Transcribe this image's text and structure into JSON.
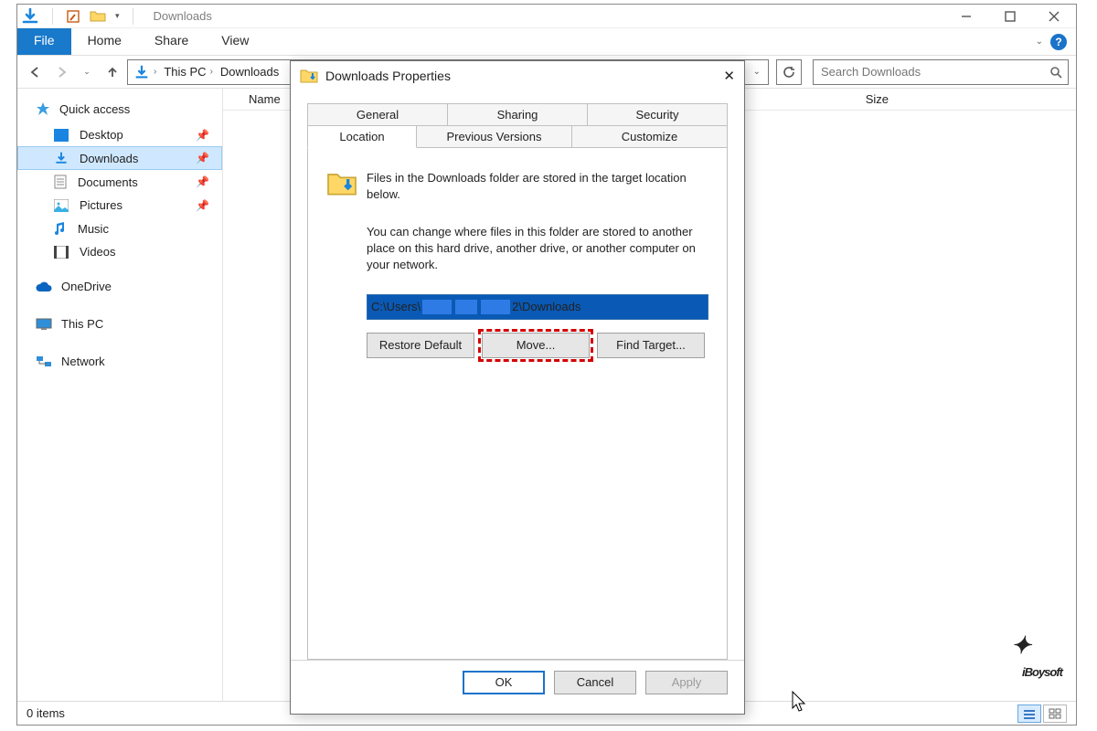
{
  "window": {
    "title": "Downloads",
    "menus": {
      "file": "File",
      "home": "Home",
      "share": "Share",
      "view": "View"
    },
    "breadcrumb": {
      "root": "This PC",
      "cur": "Downloads"
    },
    "search_placeholder": "Search Downloads",
    "columns": {
      "name": "Name",
      "size": "Size"
    },
    "status": "0 items"
  },
  "sidebar": {
    "quick_access": "Quick access",
    "items": [
      {
        "label": "Desktop",
        "icon": "desktop"
      },
      {
        "label": "Downloads",
        "icon": "downloads",
        "selected": true
      },
      {
        "label": "Documents",
        "icon": "documents"
      },
      {
        "label": "Pictures",
        "icon": "pictures"
      },
      {
        "label": "Music",
        "icon": "music"
      },
      {
        "label": "Videos",
        "icon": "videos"
      }
    ],
    "onedrive": "OneDrive",
    "thispc": "This PC",
    "network": "Network"
  },
  "dialog": {
    "title": "Downloads Properties",
    "tabs": {
      "general": "General",
      "sharing": "Sharing",
      "security": "Security",
      "location": "Location",
      "previous": "Previous Versions",
      "customize": "Customize"
    },
    "intro": "Files in the Downloads folder are stored in the target location below.",
    "desc": "You can change where files in this folder are stored to another place on this hard drive, another drive, or another computer on your network.",
    "path_prefix": "C:\\Users\\",
    "path_suffix": "2\\Downloads",
    "buttons": {
      "restore": "Restore Default",
      "move": "Move...",
      "find": "Find Target..."
    },
    "footer": {
      "ok": "OK",
      "cancel": "Cancel",
      "apply": "Apply"
    }
  },
  "brand": "iBoysoft"
}
